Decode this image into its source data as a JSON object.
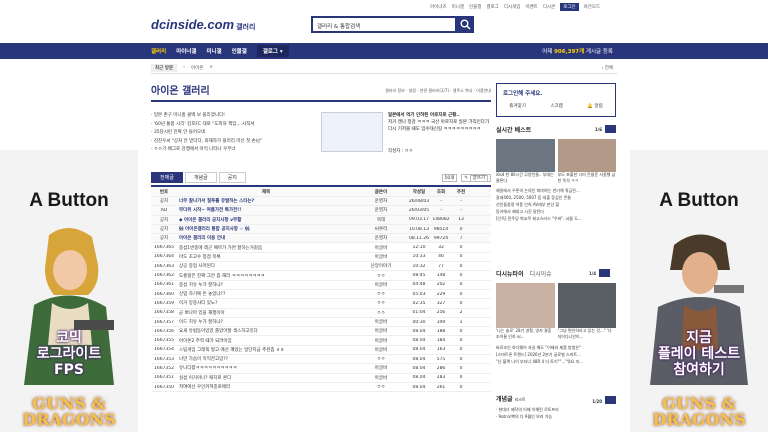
{
  "util": {
    "links": [
      "아이너츠",
      "미니갤",
      "인물갤",
      "갤로그",
      "디시게임",
      "이벤트",
      "디시콘"
    ],
    "login": "로그인",
    "night": "야간모드"
  },
  "header": {
    "logo": "dcinside.com",
    "logo_sub": "갤러리",
    "search_placeholder": "갤러리 & 통합검색"
  },
  "nav": {
    "items": [
      "갤러리",
      "마이너갤",
      "미니갤",
      "인물갤",
      "갤로그"
    ],
    "stat_prefix": "어제",
    "stat_count": "906,397개",
    "stat_suffix": "게시글 등록"
  },
  "crumb": {
    "recent": "최근 방문",
    "current": "아이온",
    "all": "전체"
  },
  "gallery": {
    "title": "아이온 갤러리",
    "menu": "갤러리 정보 · 설정 · 연관 갤러리(1/7) · 갤주소 복사 · 이용안내"
  },
  "notices": [
    {
      "title": "· 일본 촌구 미니홈 클백 보 올리겠니다!",
      "tag": "일촌형"
    },
    {
      "title": "· '60년 통합 시리' 김포FC 대로 \"도피처 책임....사직서",
      "tag": "그르네"
    },
    {
      "title": "· 35당시런 진짜 안 들어오네",
      "tag": "디씨방링"
    },
    {
      "title": "· 김진우씨 \"상처 안 받더다, 와해자가 플러리 마신 첫 손님\"",
      "tag": "ㅇㅇ"
    },
    {
      "title": "· ㅇㅇ기·배그로 강행에서 아먹 나타나 우부너",
      "tag": "탕그링사"
    }
  ],
  "featured": {
    "title": "일본에서 먹기 인하된 아로지로 근황..",
    "body": "저거 캔나 정검 ㅋㅋㅋ 국산 아로지로 일본 가직인다가 다시 기저볼 때도 임수대신링 ㅋㅋㅋㅋㅋㅋㅋㅋㅋ",
    "writer": "작성자 : ㅇㅇ",
    "page": "1/1"
  },
  "tabs": [
    "전체글",
    "개념글",
    "공지"
  ],
  "tools": [
    "50개",
    "글쓰기"
  ],
  "list_header": [
    "번호",
    "제목",
    "글쓴이",
    "작성일",
    "조회",
    "추천"
  ],
  "rows": [
    {
      "n": "공지",
      "t": "너무 잘나가서 질투를 유발하는 스타는?",
      "w": "운영자",
      "d": "26/08/03",
      "v": "-",
      "r": "-",
      "notice": true
    },
    {
      "n": "AD",
      "t": "무더위 시작~ 여름가전 특가전!!",
      "w": "운영자",
      "d": "26/03/05",
      "v": "-",
      "r": "-",
      "notice": true
    },
    {
      "n": "공지",
      "t": "◆ 아이온 갤러리 공지사항 v부활",
      "w": "목데",
      "d": "09.03.17",
      "v": "148082",
      "r": "13",
      "notice": true
    },
    {
      "n": "공지",
      "t": "§§ 아이온갤러리 통합 공지사항 ☆ §§",
      "w": "씨쿠리",
      "d": "10.08.13",
      "v": "98514",
      "r": "0",
      "notice": true
    },
    {
      "n": "공지",
      "t": "아이온 갤러리 이용 안내",
      "w": "운영자",
      "d": "08.11.26",
      "v": "99724",
      "r": "7",
      "notice": true
    },
    {
      "n": "1667365",
      "t": "중섭1번중에 레곤 예마가 가면 잘하는거같음",
      "w": "아글바",
      "d": "12:10",
      "v": "32",
      "r": "0"
    },
    {
      "n": "1667364",
      "t": "마도 초고수 정점 목록",
      "w": "아글바",
      "d": "10:33",
      "v": "46",
      "r": "0"
    },
    {
      "n": "1667363",
      "t": "상공 중업 사려된다",
      "w": "난앙이야기",
      "d": "10:32",
      "v": "77",
      "r": "0"
    },
    {
      "n": "1667362",
      "t": "도룡왕은 진짜 그만 좀 해라 ㅋㅋㅋㅋㅋㅋㅋㅋ",
      "w": "ㅇㅇ",
      "d": "08:45",
      "v": "148",
      "r": "0"
    },
    {
      "n": "1667361",
      "t": "중섭 치유 누가 잘하냐?",
      "w": "아글바",
      "d": "04:48",
      "v": "202",
      "r": "0"
    },
    {
      "n": "1667360",
      "t": "신업 하기에 돈 놓았냐??",
      "w": "ㅇㅇ",
      "d": "05:03",
      "v": "229",
      "r": "0"
    },
    {
      "n": "1667359",
      "t": "이거 망중사티 있노?",
      "w": "ㅇㅇ",
      "d": "02:35",
      "v": "327",
      "r": "0"
    },
    {
      "n": "1667358",
      "t": "곧 뽀나마 있을 재행이아",
      "w": "ㅇㅇ",
      "d": "01:04",
      "v": "256",
      "r": "2"
    },
    {
      "n": "1667357",
      "t": "이드 치유 누가 잘하냐?",
      "w": "아글바",
      "d": "00:30",
      "v": "349",
      "r": "1"
    },
    {
      "n": "1667356",
      "t": "요새 유법동아있었 쫄았어할 섹스하고잇다",
      "w": "아글바",
      "d": "08.04",
      "v": "188",
      "r": "0"
    },
    {
      "n": "1667355",
      "t": "아이온2 주력 때가 되려이임",
      "w": "아글바",
      "d": "08.04",
      "v": "184",
      "r": "0"
    },
    {
      "n": "1667354",
      "t": "스팀게임 그래픽 평고 애산 깨었는 일단지금 추천좀 ㅎㅎ",
      "w": "아글바",
      "d": "08.04",
      "v": "163",
      "r": "0"
    },
    {
      "n": "1667353",
      "t": "나만 가슴이 먹먹한고맘??",
      "w": "ㅇㅇ",
      "d": "08.04",
      "v": "575",
      "r": "0"
    },
    {
      "n": "1667352",
      "t": "유니더팝ㅋㅋㅋㅋㅋㅋㅋㅋㅋㅋ",
      "w": "아글바",
      "d": "08.04",
      "v": "286",
      "r": "0"
    },
    {
      "n": "1667351",
      "t": "실섬 이거아나? 패치로 온다",
      "w": "아글바",
      "d": "08.04",
      "v": "283",
      "r": "0"
    },
    {
      "n": "1667350",
      "t": "저여에선 우인커져중로애라",
      "w": "ㅇㅇ",
      "d": "08.04",
      "v": "261",
      "r": "0"
    }
  ],
  "side": {
    "login_title": "로그인해 주세요.",
    "login_links": [
      "즐겨찾기",
      "스크랩",
      "알림"
    ],
    "best_title": "실시간 베스트",
    "best_page": "1/6",
    "best_caps": [
      "i6sd 한 80시간 무양인물.. 부대는 물론다",
      "부도 포흘한 시미 돈들운 사용했 남한 독석 ㅋㅋ"
    ],
    "best_list": [
      "제일에서 우론의 논의인 퇴마여는 연기해 줘금된...",
      "갈레400, 2500, 5007 등 대출 증심인 몬물",
      "선인돌중정 약풍 인희 AV레부 만난 할",
      "동키에서 제대고 시진 달탄다",
      "[단독] 민주당 박교쿠 회고스러스 \"우바\"..서름 도..."
    ],
    "dcs_title": "디시뉴타이",
    "dcs_sub": "디시이슈",
    "dcs_page": "1/4",
    "dcs_caps": [
      "'나는 솔로' 28기 영철, 영자 결혼 조이율 인하 씨...",
      "\"그냥 편안하라고 있는 것...\" '다 지이다니안이..."
    ],
    "dcs_list": [
      "바로조인 하다웨어 자길 해도 \"이제와 제품 방법은\"",
      "[스마트폰 트렌드] 2026년 2분기 글로벌 스마트...",
      "\"난 블랙 나이 부터너 48R 4 더 토이\"\"...\"뭐요 지..."
    ],
    "concept_title": "개념글",
    "concept_sub": "리스트",
    "concept_page": "1/20",
    "concept_list": [
      "· 현대녀 제작의 어제 이해된 르토프라",
      "· 9atn오빡의 다 9월인 보러 가능"
    ]
  },
  "ads": {
    "brand": "A Button",
    "left_copy": [
      "코믹",
      "로그라이트",
      "FPS"
    ],
    "right_copy": [
      "지금",
      "플레이 테스트",
      "참여하기"
    ],
    "logo": "GUNS & DRAGONS"
  }
}
